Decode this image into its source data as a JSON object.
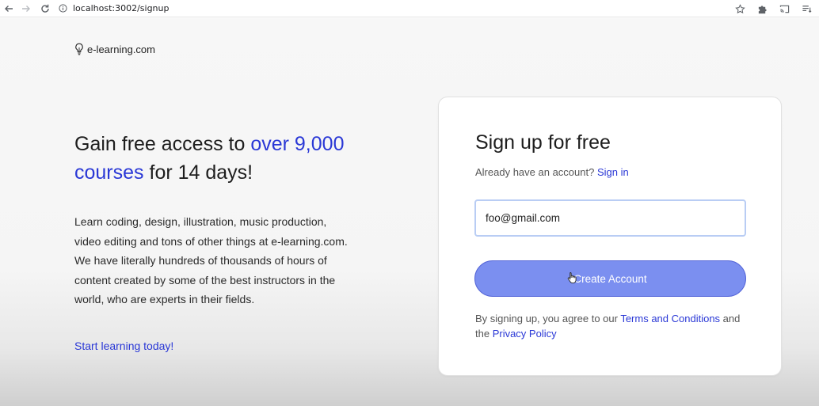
{
  "browser": {
    "url": "localhost:3002/signup",
    "icons": {
      "back": "arrow-left-icon",
      "forward": "arrow-right-icon",
      "reload": "reload-icon",
      "site_info": "info-icon",
      "bookmark": "star-icon",
      "extensions": "puzzle-icon",
      "cast": "cast-icon",
      "reading_list": "reading-list-icon"
    }
  },
  "brand": {
    "name": "e-learning.com",
    "icon": "lightbulb-icon"
  },
  "hero": {
    "part1": "Gain free access to ",
    "highlight": "over 9,000 courses",
    "part2": " for 14 days!"
  },
  "description": "Learn coding, design, illustration, music production, video editing and tons of other things at e-learning.com. We have literally hundreds of thousands of hours of content created by some of the best instructors in the world, who are experts in their fields.",
  "cta_link": "Start learning today!",
  "signup_card": {
    "title": "Sign up for free",
    "already_text": "Already have an account?",
    "signin_link": "Sign in",
    "email_value": "foo@gmail.com",
    "create_button": "Create Account",
    "terms_prefix": "By signing up, you agree to our ",
    "terms_link": "Terms and Conditions",
    "terms_middle": " and the ",
    "privacy_link": "Privacy Policy"
  },
  "colors": {
    "accent": "#2a38d6",
    "button": "#7b8ff0",
    "input_border": "#b9cdf4"
  }
}
